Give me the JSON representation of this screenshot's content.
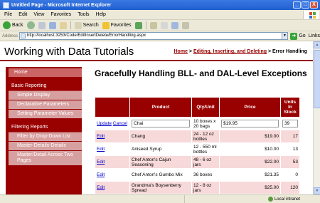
{
  "window": {
    "title": "Untitled Page - Microsoft Internet Explorer",
    "minimize": "_",
    "maximize": "□",
    "close": "X"
  },
  "menu": [
    "File",
    "Edit",
    "View",
    "Favorites",
    "Tools",
    "Help"
  ],
  "toolbar": {
    "back": "Back",
    "search": "Search",
    "favorites": "Favorites"
  },
  "address": {
    "label": "Address",
    "url": "http://localhost:3253/Code/EditInsertDelete/ErrorHandling.aspx",
    "go": "Go",
    "links": "Links"
  },
  "page": {
    "site_title": "Working with Data Tutorials",
    "breadcrumb": {
      "home": "Home",
      "sep1": " > ",
      "section": "Editing, Inserting, and Deleting",
      "sep2": " > ",
      "current": "Error Handling"
    },
    "heading": "Gracefully Handling BLL- and DAL-Level Exceptions"
  },
  "sidebar": {
    "items": [
      {
        "label": "Home",
        "type": "head"
      },
      {
        "label": "Basic Reporting",
        "type": "head"
      },
      {
        "label": "Simple Display",
        "type": "item"
      },
      {
        "label": "Declarative Parameters",
        "type": "item"
      },
      {
        "label": "Setting Parameter Values",
        "type": "item"
      },
      {
        "label": "Filtering Reports",
        "type": "head"
      },
      {
        "label": "Filter by Drop-Down List",
        "type": "item"
      },
      {
        "label": "Master-Details-Details",
        "type": "item"
      },
      {
        "label": "Master/Detail Across Two Pages",
        "type": "item"
      }
    ]
  },
  "grid": {
    "headers": [
      "",
      "Product",
      "Qty/Unit",
      "Price",
      "Units In Stock"
    ],
    "edit_row": {
      "update": "Update",
      "cancel": "Cancel",
      "product": "Chai",
      "qty": "10 boxes x 20 bags",
      "price": "$19.95",
      "stock": "39"
    },
    "rows": [
      {
        "action": "Edit",
        "product": "Chang",
        "qty": "24 - 12 oz bottles",
        "price": "$19.00",
        "stock": "17"
      },
      {
        "action": "Edit",
        "product": "Aniseed Syrup",
        "qty": "12 - 550 ml bottles",
        "price": "$10.00",
        "stock": "13"
      },
      {
        "action": "Edit",
        "product": "Chef Anton's Cajun Seasoning",
        "qty": "48 - 6 oz jars",
        "price": "$22.00",
        "stock": "53"
      },
      {
        "action": "Edit",
        "product": "Chef Anton's Gumbo Mix",
        "qty": "36 boxes",
        "price": "$21.35",
        "stock": "0"
      },
      {
        "action": "Edit",
        "product": "Grandma's Boysenberry Spread",
        "qty": "12 - 8 oz jars",
        "price": "$25.00",
        "stock": "120"
      }
    ]
  },
  "status": {
    "zone": "Local intranet"
  }
}
